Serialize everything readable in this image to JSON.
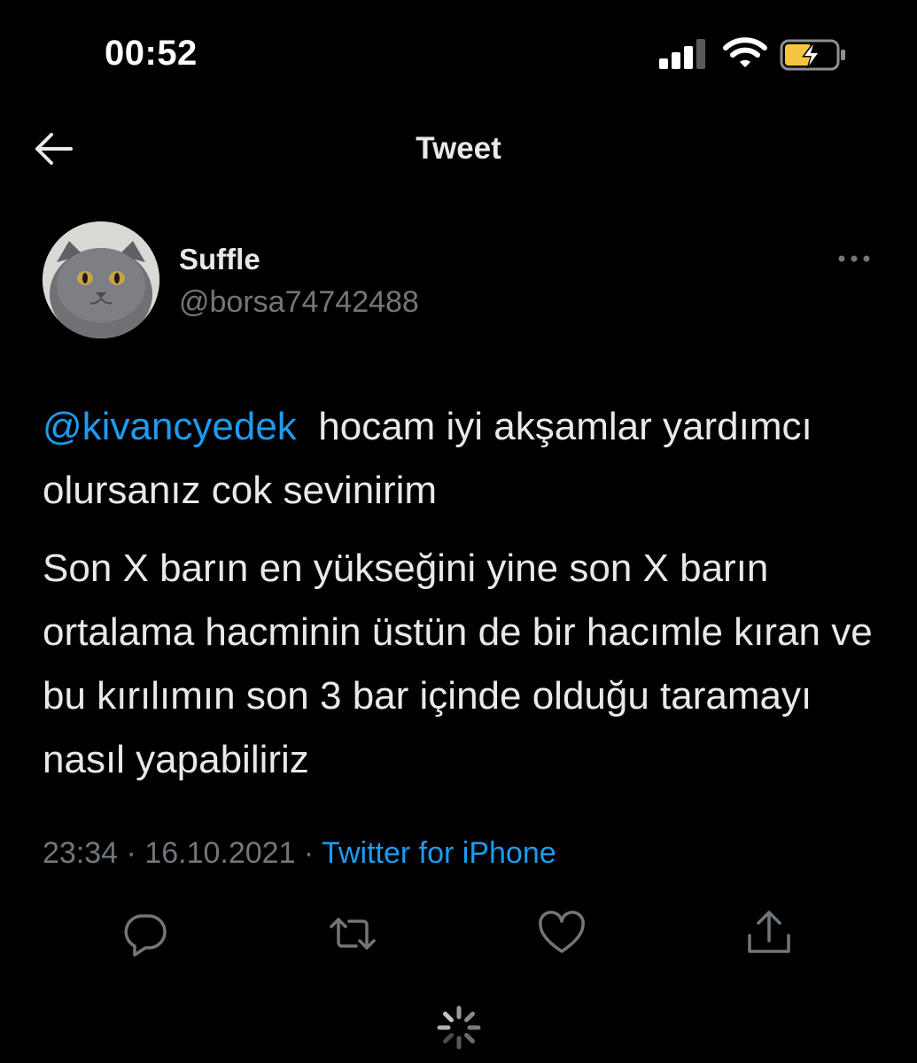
{
  "status_bar": {
    "time": "00:52",
    "icons": [
      "cellular-signal-icon",
      "wifi-icon",
      "battery-charging-icon"
    ],
    "battery_color": "#f5c542"
  },
  "header": {
    "title": "Tweet",
    "back_icon": "arrow-left-icon"
  },
  "tweet": {
    "author": {
      "display_name": "Suffle",
      "handle": "@borsa74742488",
      "avatar": "gray-cat-avatar"
    },
    "mention": "@kivancyedek",
    "paragraph1_rest": "  hocam iyi akşamlar yardımcı olursanız cok sevinirim",
    "paragraph2": "Son X barın en yükseğini yine son X barın ortalama hacminin üstün de bir hacımle kıran ve bu kırılımın son 3 bar içinde olduğu taramayı nasıl yapabiliriz",
    "time": "23:34",
    "separator": " · ",
    "date": "16.10.2021",
    "source": "Twitter for iPhone"
  },
  "actions": [
    "reply-icon",
    "retweet-icon",
    "like-icon",
    "share-icon"
  ],
  "colors": {
    "background": "#000000",
    "text": "#e7e9ea",
    "secondary": "#71767b",
    "accent": "#1d9bf0"
  }
}
